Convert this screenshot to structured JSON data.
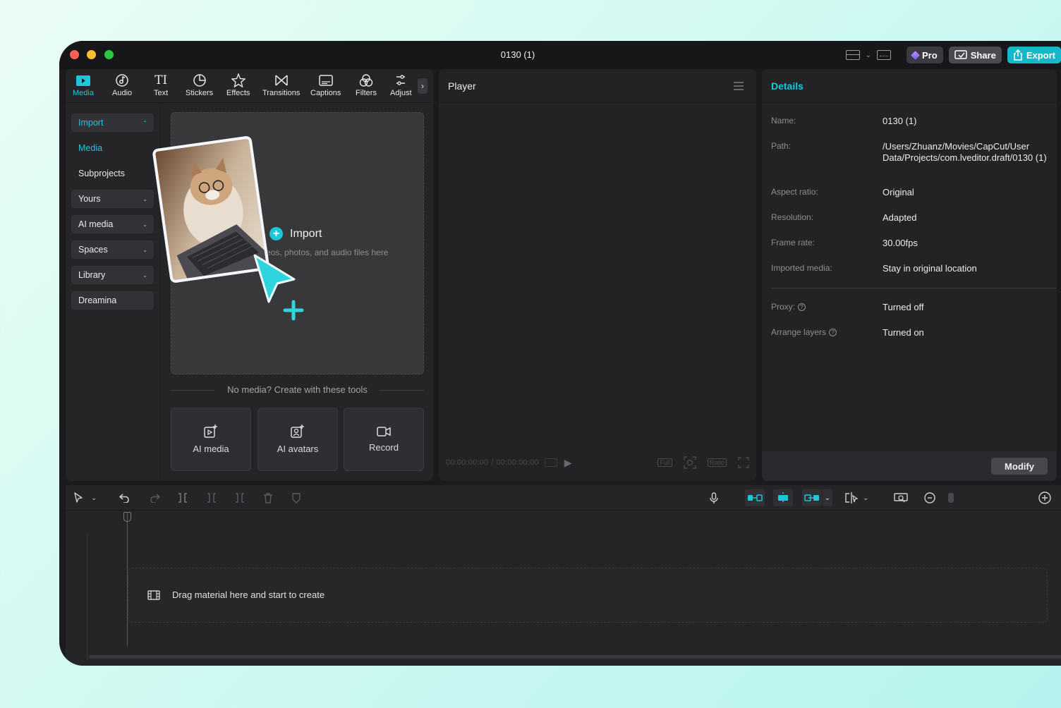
{
  "window": {
    "title": "0130 (1)"
  },
  "titlebar": {
    "pro_label": "Pro",
    "share_label": "Share",
    "export_label": "Export"
  },
  "toolbar": {
    "tabs": [
      {
        "label": "Media",
        "icon": "media-play-icon",
        "active": true
      },
      {
        "label": "Audio",
        "icon": "audio-icon"
      },
      {
        "label": "Text",
        "icon": "text-icon"
      },
      {
        "label": "Stickers",
        "icon": "sticker-icon"
      },
      {
        "label": "Effects",
        "icon": "effects-star-icon"
      },
      {
        "label": "Transitions",
        "icon": "transitions-icon"
      },
      {
        "label": "Captions",
        "icon": "captions-icon"
      },
      {
        "label": "Filters",
        "icon": "filters-icon"
      },
      {
        "label": "Adjust",
        "icon": "adjust-icon"
      }
    ]
  },
  "sidebar": {
    "items": [
      {
        "label": "Import",
        "active": true,
        "dropdown": true
      },
      {
        "label": "Media",
        "active": true
      },
      {
        "label": "Subprojects"
      },
      {
        "label": "Yours",
        "dropdown": true
      },
      {
        "label": "AI media",
        "dropdown": true
      },
      {
        "label": "Spaces",
        "dropdown": true
      },
      {
        "label": "Library",
        "dropdown": true
      },
      {
        "label": "Dreamina"
      }
    ]
  },
  "media": {
    "import_label": "Import",
    "import_hint": "eos, photos, and audio files here",
    "no_media_text": "No media? Create with these tools",
    "tools": [
      {
        "label": "AI media",
        "icon": "ai-media-icon"
      },
      {
        "label": "AI avatars",
        "icon": "ai-avatar-icon"
      },
      {
        "label": "Record",
        "icon": "record-camera-icon"
      }
    ]
  },
  "player": {
    "title": "Player",
    "time_current": "00:00:00:00",
    "time_separator": "/",
    "time_total": "00:00:00:00",
    "full_label": "Full",
    "ratio_label": "Ratio"
  },
  "details": {
    "title": "Details",
    "rows": [
      {
        "label": "Name:",
        "value": "0130 (1)"
      },
      {
        "label": "Path:",
        "value": "/Users/Zhuanz/Movies/CapCut/User Data/Projects/com.lveditor.draft/0130 (1)"
      },
      {
        "label": "Aspect ratio:",
        "value": "Original"
      },
      {
        "label": "Resolution:",
        "value": "Adapted"
      },
      {
        "label": "Frame rate:",
        "value": "30.00fps"
      },
      {
        "label": "Imported media:",
        "value": "Stay in original location"
      },
      {
        "label": "Proxy:",
        "value": "Turned off"
      },
      {
        "label": "Arrange layers",
        "value": "Turned on"
      }
    ],
    "modify_label": "Modify"
  },
  "timeline": {
    "drop_hint": "Drag material here and start to create"
  },
  "colors": {
    "accent": "#1ec6d9",
    "background": "#1b1b1d",
    "panel": "#252528"
  }
}
